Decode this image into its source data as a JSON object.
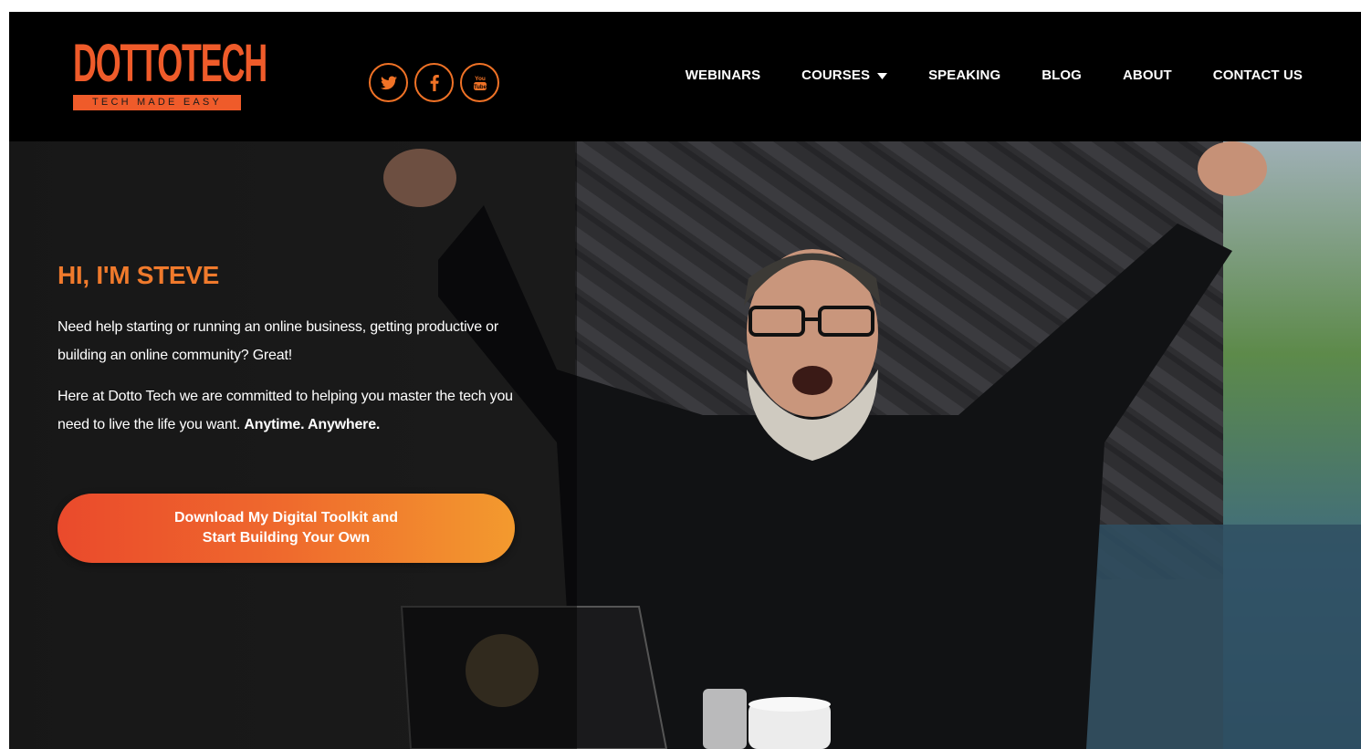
{
  "brand": {
    "logo_word": "DOTTOTECH",
    "tagline": "TECH MADE EASY",
    "accent": "#ef5b2a",
    "cta_gradient": [
      "#ea4a2c",
      "#f39a2e"
    ]
  },
  "socials": [
    {
      "name": "twitter-icon",
      "label": "Twitter"
    },
    {
      "name": "facebook-icon",
      "label": "Facebook"
    },
    {
      "name": "youtube-icon",
      "label": "YouTube"
    }
  ],
  "nav": {
    "items": [
      {
        "label": "WEBINARS",
        "has_dropdown": false
      },
      {
        "label": "COURSES",
        "has_dropdown": true
      },
      {
        "label": "SPEAKING",
        "has_dropdown": false
      },
      {
        "label": "BLOG",
        "has_dropdown": false
      },
      {
        "label": "ABOUT",
        "has_dropdown": false
      },
      {
        "label": "CONTACT US",
        "has_dropdown": false
      }
    ]
  },
  "hero": {
    "title": "HI, I'M STEVE",
    "paragraph1": "Need help starting or running an online business, getting productive or building an online community? Great!",
    "paragraph2_lead": "Here at Dotto Tech we are committed to helping you master the tech you need to live the life you want.",
    "paragraph2_bold": "Anytime. Anywhere.",
    "cta_line1": "Download My Digital Toolkit and",
    "cta_line2": "Start Building Your Own"
  }
}
